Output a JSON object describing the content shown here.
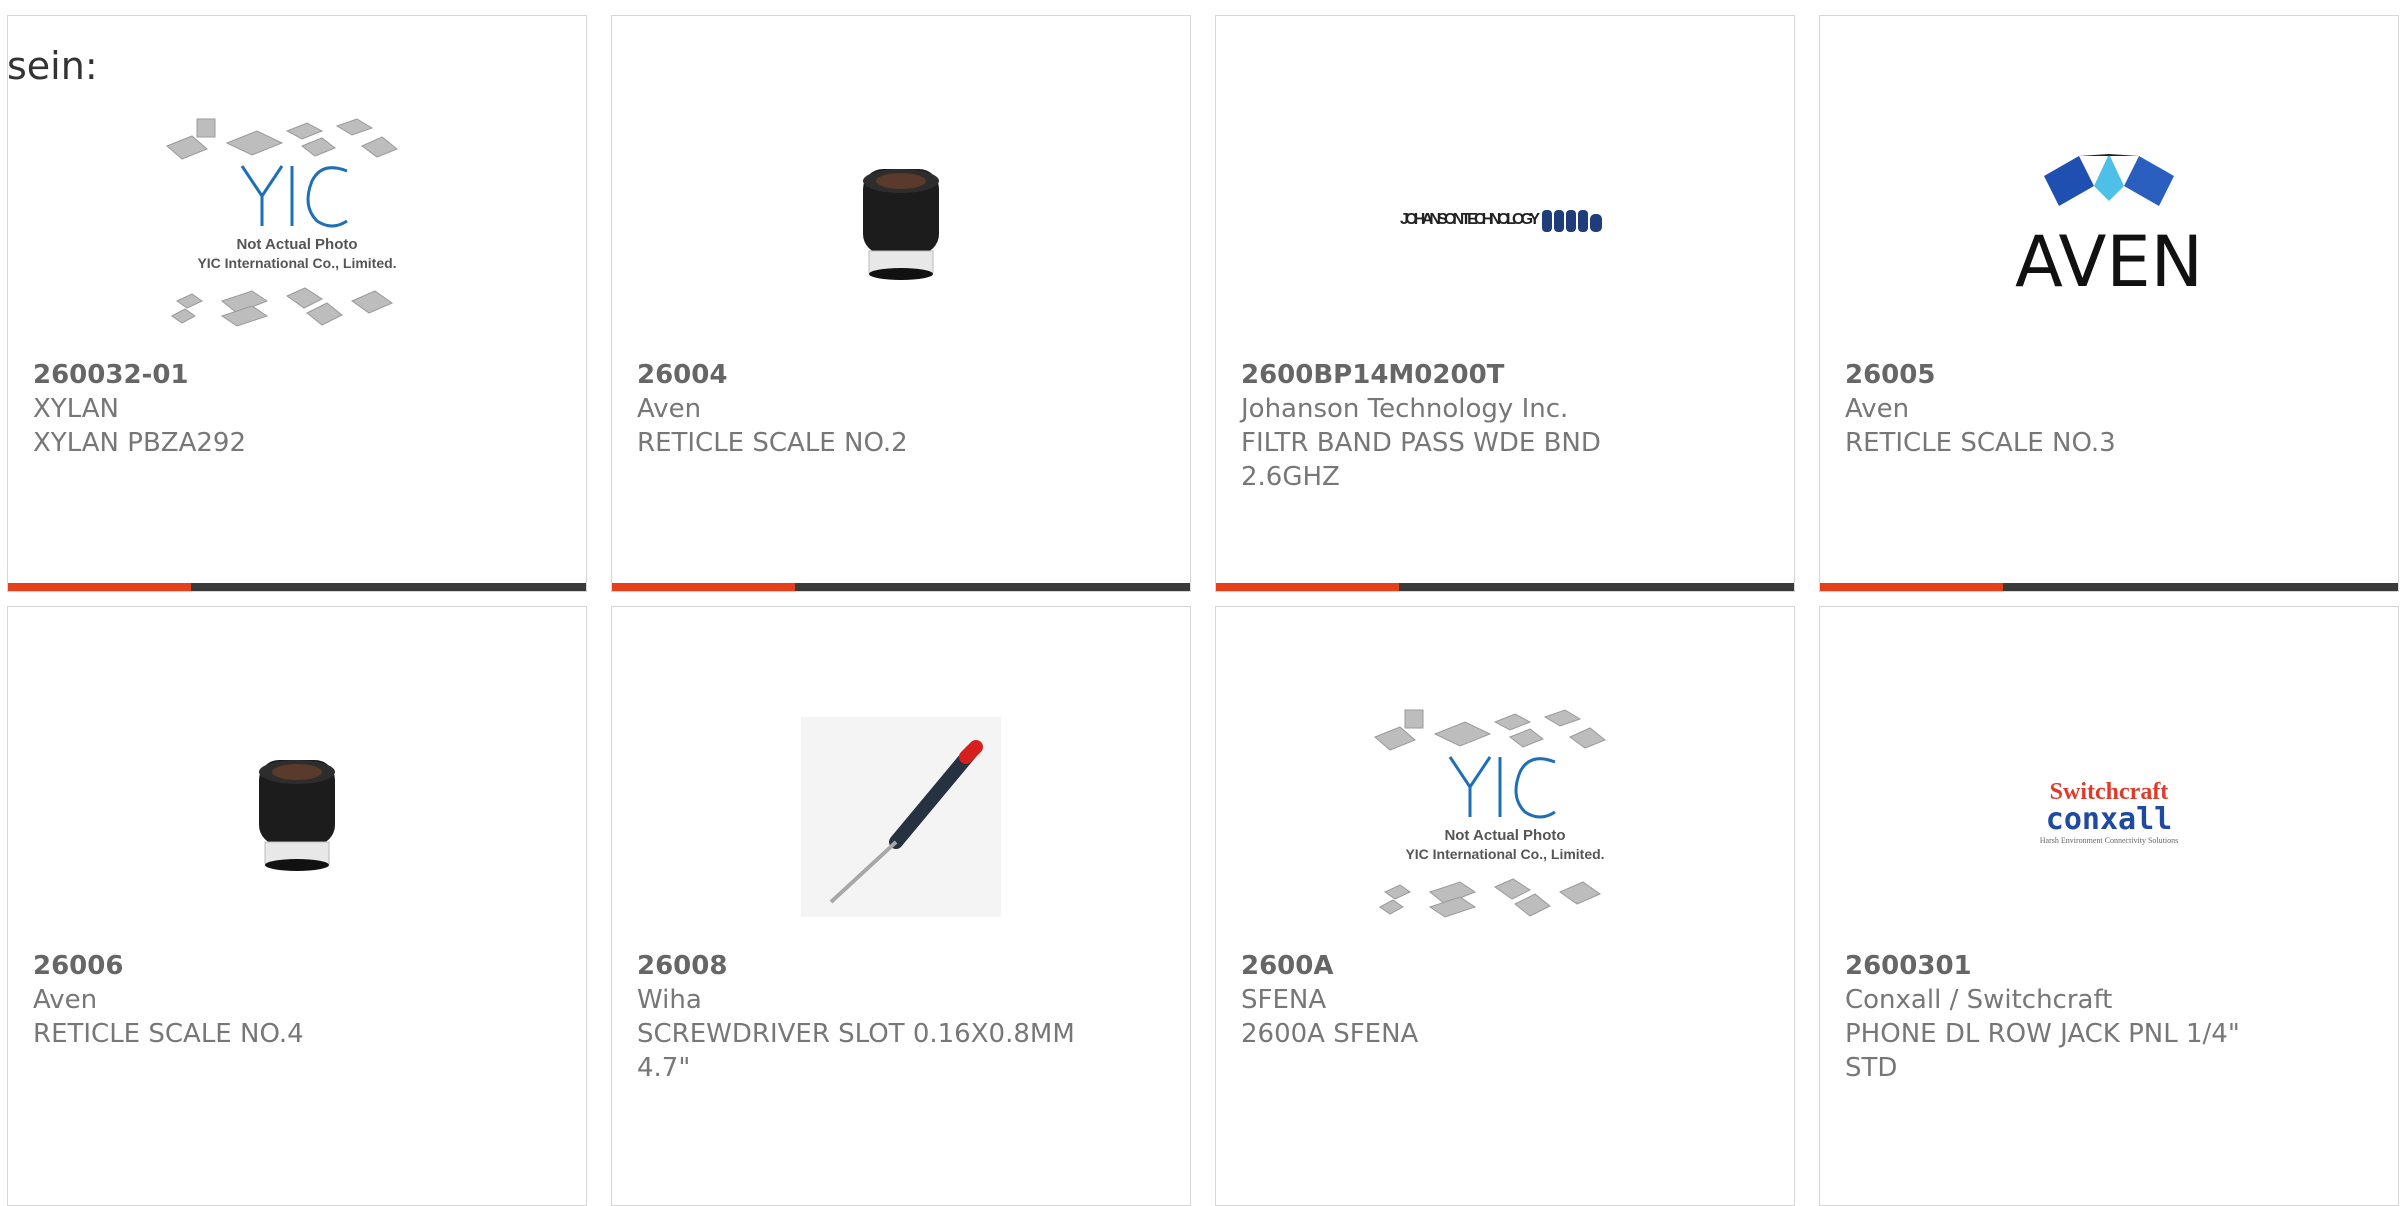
{
  "prefix_text": "sein:",
  "products": [
    {
      "part": "260032-01",
      "manufacturer": "XYLAN",
      "description": "XYLAN PBZA292",
      "image": "yic-placeholder",
      "img_caption_1": "Not Actual Photo",
      "img_caption_2": "YIC International Co., Limited."
    },
    {
      "part": "26004",
      "manufacturer": "Aven",
      "description": "RETICLE SCALE NO.2",
      "image": "loupe-photo"
    },
    {
      "part": "2600BP14M0200T",
      "manufacturer": "Johanson Technology Inc.",
      "description": "FILTR BAND PASS WDE BND 2.6GHZ",
      "image": "johanson-logo",
      "logo_text": "JOHANSON TECHNOLOGY"
    },
    {
      "part": "26005",
      "manufacturer": "Aven",
      "description": "RETICLE SCALE NO.3",
      "image": "aven-logo",
      "logo_text": "AVEN"
    },
    {
      "part": "26006",
      "manufacturer": "Aven",
      "description": "RETICLE SCALE NO.4",
      "image": "loupe-photo"
    },
    {
      "part": "26008",
      "manufacturer": "Wiha",
      "description": "SCREWDRIVER SLOT 0.16X0.8MM 4.7\"",
      "image": "screwdriver-photo"
    },
    {
      "part": "2600A",
      "manufacturer": "SFENA",
      "description": "2600A SFENA",
      "image": "yic-placeholder",
      "img_caption_1": "Not Actual Photo",
      "img_caption_2": "YIC International Co., Limited."
    },
    {
      "part": "2600301",
      "manufacturer": "Conxall / Switchcraft",
      "description": "PHONE DL ROW JACK PNL 1/4\" STD",
      "image": "switchcraft-logo",
      "logo_text_1": "Switchcraft",
      "logo_text_2": "conxall",
      "logo_text_3": "Harsh Environment Connectivity Solutions"
    }
  ],
  "colors": {
    "accent": "#e5401c",
    "bar": "#3a3a3a",
    "border": "#d6d6d6",
    "text": "#666666"
  }
}
